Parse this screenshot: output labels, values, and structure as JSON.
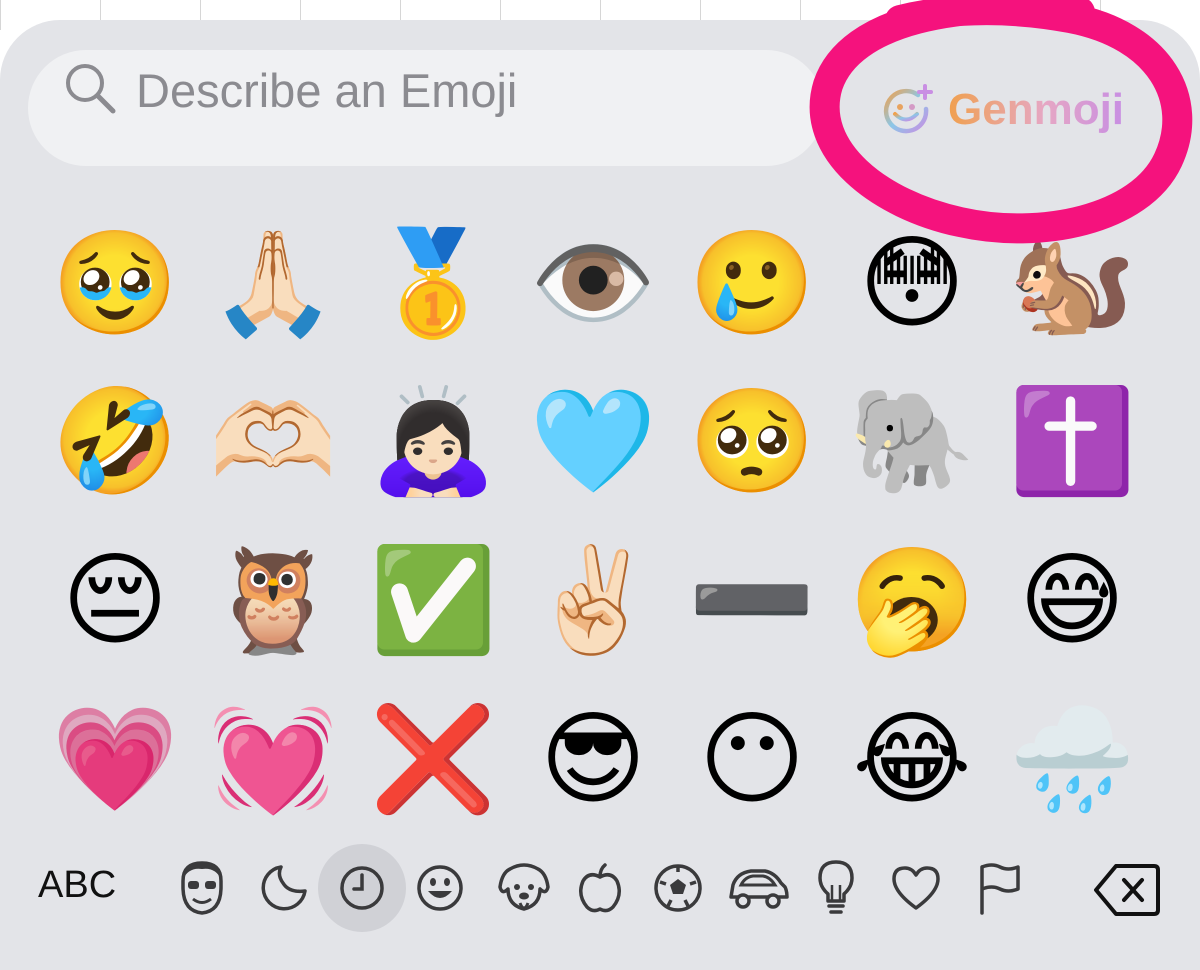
{
  "search": {
    "placeholder": "Describe an Emoji",
    "value": ""
  },
  "genmoji": {
    "label": "Genmoji",
    "icon": "smiley-plus-icon"
  },
  "annotation": {
    "color": "#f5127d",
    "shape": "hand-drawn circle around Genmoji button"
  },
  "emoji_grid": {
    "rows": [
      [
        "🥹",
        "🙏🏻",
        "🥇",
        "👁️",
        "🥲",
        "😳",
        "🐿️"
      ],
      [
        "🤣",
        "🫶🏻",
        "🙇🏻‍♀️",
        "🩵",
        "🥺",
        "🐘",
        "✝️"
      ],
      [
        "😔",
        "🦉",
        "✅",
        "✌🏻",
        "➖",
        "🥱",
        "😅"
      ],
      [
        "💗",
        "💓",
        "❌",
        "😎",
        "😶",
        "😂",
        "🌧️"
      ]
    ]
  },
  "category_bar": {
    "abc_label": "ABC",
    "tabs": [
      {
        "name": "memoji-stickers",
        "icon": "memoji-face-icon"
      },
      {
        "name": "stickers",
        "icon": "sticker-icon"
      },
      {
        "name": "recents",
        "icon": "clock-icon",
        "selected": true
      },
      {
        "name": "smileys",
        "icon": "smiley-icon"
      },
      {
        "name": "animals",
        "icon": "dog-icon"
      },
      {
        "name": "food",
        "icon": "apple-icon"
      },
      {
        "name": "activity",
        "icon": "soccer-ball-icon"
      },
      {
        "name": "travel",
        "icon": "car-icon"
      },
      {
        "name": "objects",
        "icon": "lightbulb-icon"
      },
      {
        "name": "symbols",
        "icon": "heart-icon"
      },
      {
        "name": "flags",
        "icon": "flag-icon"
      }
    ],
    "delete_icon": "backspace-icon"
  },
  "colors": {
    "keyboard_bg": "#e3e4e8",
    "search_bg": "#f0f1f3",
    "placeholder": "#8b8b90",
    "selected_tab_bg": "#d0d1d6"
  }
}
